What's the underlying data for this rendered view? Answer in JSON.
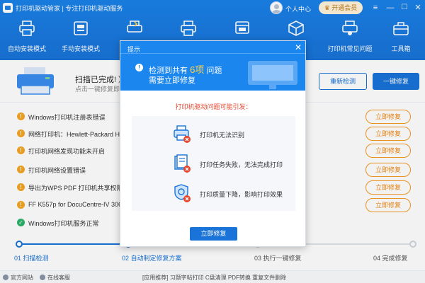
{
  "window": {
    "title": "打印机驱动管家 | 专注打印机驱动服务",
    "user_center": "个人中心",
    "vip_button": "开通会员",
    "min_glyph": "—",
    "max_glyph": "☐",
    "close_glyph": "✕"
  },
  "toolbar": {
    "items": [
      {
        "label": "自动安装模式",
        "icon": "printer-icon"
      },
      {
        "label": "手动安装模式",
        "icon": "driver-box-icon"
      },
      {
        "label": "",
        "icon": "repair-printer-icon"
      },
      {
        "label": "",
        "icon": "printer-icon"
      },
      {
        "label": "",
        "icon": "window-icon"
      },
      {
        "label": "",
        "icon": "package-icon"
      },
      {
        "label": "打印机常见问题",
        "icon": "help-printer-icon"
      },
      {
        "label": "工具箱",
        "icon": "toolbox-icon"
      }
    ]
  },
  "status": {
    "title": "扫描已完成! 》",
    "subtitle": "点击一键修复即可",
    "rescan": "重新检测",
    "fix_all": "一键修复"
  },
  "issues": [
    {
      "text": "Windows打印机注册表错误",
      "status": "warning",
      "action": "立即修复"
    },
    {
      "text": "网络打印机：Hewlett-Packard HP I",
      "status": "warning",
      "action": "立即修复"
    },
    {
      "text": "打印机网络发现功能未开启",
      "status": "warning",
      "action": "立即修复"
    },
    {
      "text": "打印机网络设置错误",
      "status": "warning",
      "action": "立即修复"
    },
    {
      "text": "导出为WPS PDF 打印机共享权限不足",
      "status": "warning",
      "action": "立即修复"
    },
    {
      "text": "FF K557p for DocuCentre-IV 3065",
      "status": "warning",
      "action": "立即修复"
    },
    {
      "text": "Windows打印机服务正常",
      "status": "ok",
      "action": ""
    }
  ],
  "steps": [
    {
      "label": "01 扫描检测",
      "state": "done"
    },
    {
      "label": "02 自动制定修复方案",
      "state": "active"
    },
    {
      "label": "03 执行一键修复",
      "state": "pending"
    },
    {
      "label": "04 完成修复",
      "state": "pending"
    }
  ],
  "footer": {
    "site": "官方网站",
    "support": "在线客服",
    "links": "[应用推荐]   习题字帖打印   C盘清理   PDF转换   重复文件删除"
  },
  "modal": {
    "title": "提示",
    "close_glyph": "✕",
    "warn_glyph": "!",
    "detect_prefix": "检测到共有",
    "detect_count": "6项",
    "detect_suffix": "问题",
    "need_fix": "需要立即修复",
    "cause_title": "打印机驱动问题可能引发：",
    "causes": [
      {
        "text": "打印机无法识别",
        "icon": "printer-error-icon"
      },
      {
        "text": "打印任务失败，无法完成打印",
        "icon": "document-error-icon"
      },
      {
        "text": "打印质量下降，影响打印效果",
        "icon": "quality-error-icon"
      }
    ],
    "fix_button": "立即修复"
  },
  "colors": {
    "brand": "#1973d8",
    "warning": "#f5a623",
    "ok": "#2db36b",
    "alert_text": "#e8452c"
  }
}
